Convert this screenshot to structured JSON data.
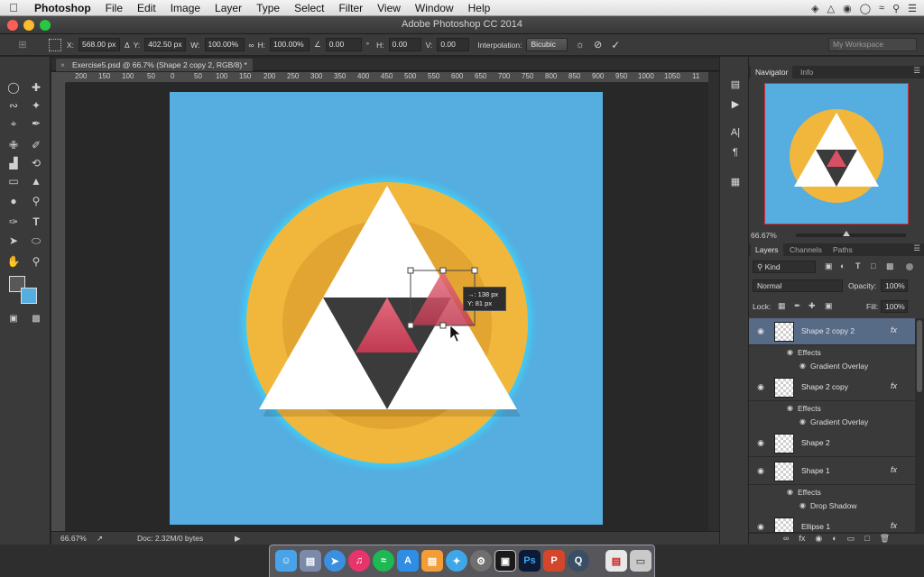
{
  "menubar": {
    "items": [
      "Photoshop",
      "File",
      "Edit",
      "Image",
      "Layer",
      "Type",
      "Select",
      "Filter",
      "View",
      "Window",
      "Help"
    ],
    "status_icons": [
      "dropbox-icon",
      "shield-icon",
      "record-icon",
      "globe-icon",
      "wifi-icon",
      "search-icon",
      "list-icon"
    ]
  },
  "window": {
    "title": "Adobe Photoshop CC 2014"
  },
  "options": {
    "x_label": "X:",
    "x_value": "568.00 px",
    "y_label": "Y:",
    "y_value": "402.50 px",
    "w_label": "W:",
    "w_value": "100.00%",
    "h_label": "H:",
    "h_value": "100.00%",
    "angle_value": "0.00",
    "hskew_label": "H:",
    "hskew_value": "0.00",
    "vskew_label": "V:",
    "vskew_value": "0.00",
    "interp_label": "Interpolation:",
    "interp_value": "Bicubic",
    "workspace": "My Workspace"
  },
  "document": {
    "tab_label": "Exercise5.psd @ 66.7% (Shape 2 copy 2, RGB/8) *",
    "ruler_labels": [
      "200",
      "150",
      "100",
      "50",
      "0",
      "50",
      "100",
      "150",
      "200",
      "250",
      "300",
      "350",
      "400",
      "450",
      "500",
      "550",
      "600",
      "650",
      "700",
      "750",
      "800",
      "850",
      "900",
      "950",
      "1000",
      "1050",
      "11"
    ],
    "transform_tooltip": {
      "x": "→: 138 px",
      "y": "Y: 81 px"
    },
    "zoom": "66.67%",
    "doc_size": "Doc: 2.32M/0 bytes"
  },
  "colors": {
    "canvas_bg": "#56addf",
    "circle": "#f1b73d",
    "triangle": "#ffffff",
    "dark": "#3b3b3b",
    "accent": "#d94f65"
  },
  "navigator": {
    "tabs": [
      "Navigator",
      "Info"
    ],
    "zoom": "66.67%"
  },
  "layers_panel": {
    "tabs": [
      "Layers",
      "Channels",
      "Paths"
    ],
    "filter_kind": "Kind",
    "blend_mode": "Normal",
    "opacity_label": "Opacity:",
    "opacity_value": "100%",
    "lock_label": "Lock:",
    "fill_label": "Fill:",
    "fill_value": "100%",
    "layers": [
      {
        "name": "Shape 2 copy 2",
        "fx": "fx",
        "effects_label": "Effects",
        "effect": "Gradient Overlay"
      },
      {
        "name": "Shape 2 copy",
        "fx": "fx",
        "effects_label": "Effects",
        "effect": "Gradient Overlay"
      },
      {
        "name": "Shape 2"
      },
      {
        "name": "Shape 1",
        "fx": "fx",
        "effects_label": "Effects",
        "effect": "Drop Shadow"
      },
      {
        "name": "Ellipse 1",
        "fx": "fx"
      }
    ]
  },
  "dock": {
    "apps": [
      "finder-icon",
      "preview-icon",
      "safari-icon",
      "itunes-icon",
      "spotify-icon",
      "app-store-icon",
      "ibooks-icon",
      "twitter-icon",
      "system-preferences-icon",
      "screen-capture-icon",
      "photoshop-icon",
      "powerpoint-icon",
      "quicktime-icon",
      "acrobat-icon",
      "trash-icon"
    ],
    "ps_label": "Ps",
    "p_label": "P"
  }
}
